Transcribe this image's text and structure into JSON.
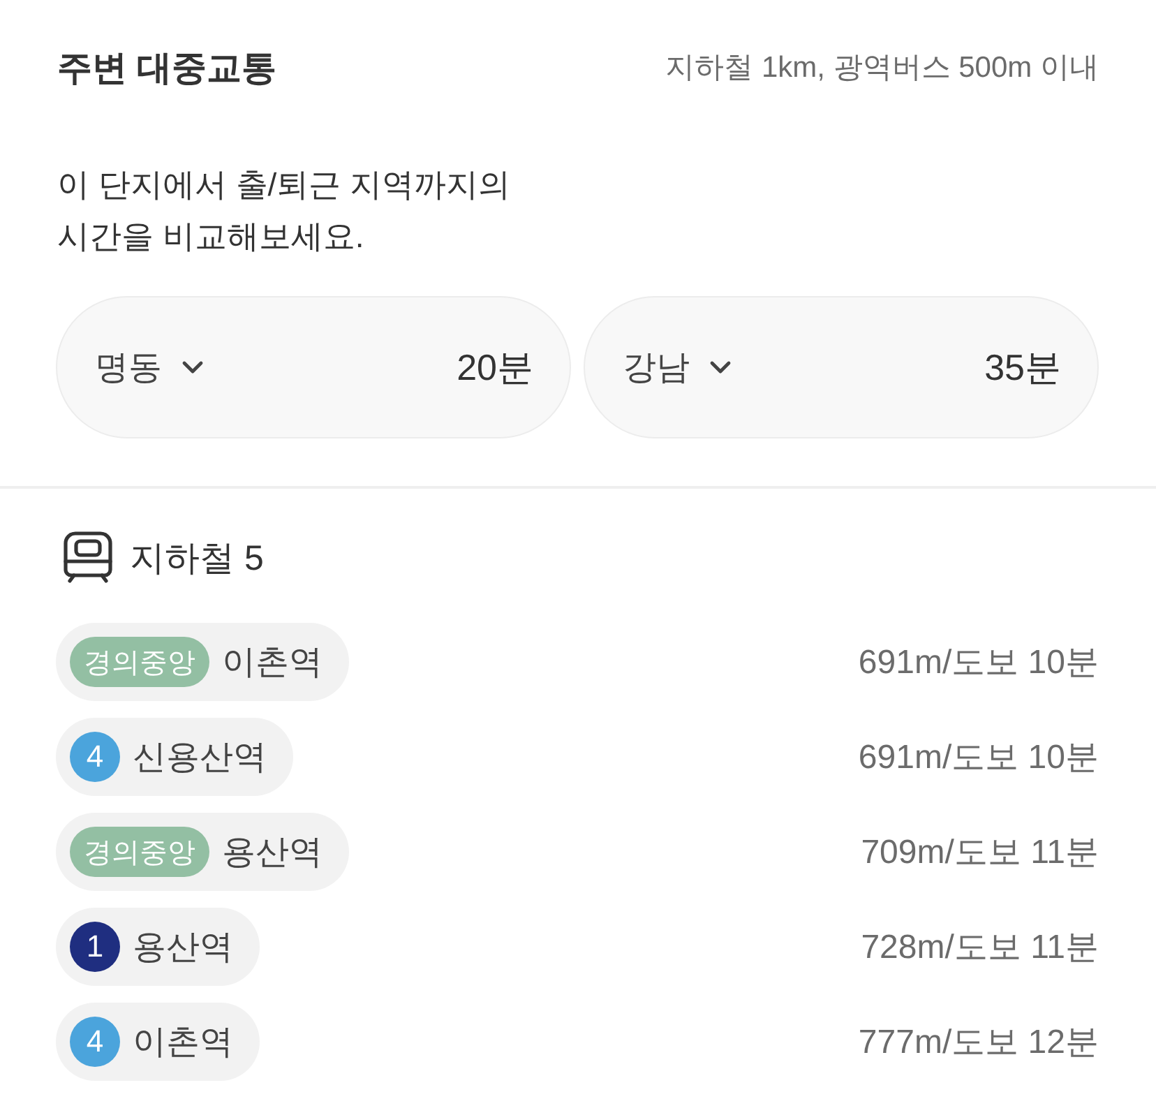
{
  "header": {
    "title": "주변 대중교통",
    "criteria": "지하철 1km, 광역버스 500m 이내"
  },
  "description": "이 단지에서 출/퇴근 지역까지의\n시간을 비교해보세요.",
  "commutes": [
    {
      "destination": "명동",
      "time": "20분"
    },
    {
      "destination": "강남",
      "time": "35분"
    }
  ],
  "subway": {
    "label": "지하철 5",
    "stations": [
      {
        "line": {
          "kind": "name",
          "text": "경의중앙",
          "color": "#93bfa3"
        },
        "name": "이촌역",
        "distance": "691m/도보 10분"
      },
      {
        "line": {
          "kind": "number",
          "text": "4",
          "color": "#4ba4dc"
        },
        "name": "신용산역",
        "distance": "691m/도보 10분"
      },
      {
        "line": {
          "kind": "name",
          "text": "경의중앙",
          "color": "#93bfa3"
        },
        "name": "용산역",
        "distance": "709m/도보 11분"
      },
      {
        "line": {
          "kind": "number",
          "text": "1",
          "color": "#1f2e80"
        },
        "name": "용산역",
        "distance": "728m/도보 11분"
      },
      {
        "line": {
          "kind": "number",
          "text": "4",
          "color": "#4ba4dc"
        },
        "name": "이촌역",
        "distance": "777m/도보 12분"
      }
    ]
  }
}
